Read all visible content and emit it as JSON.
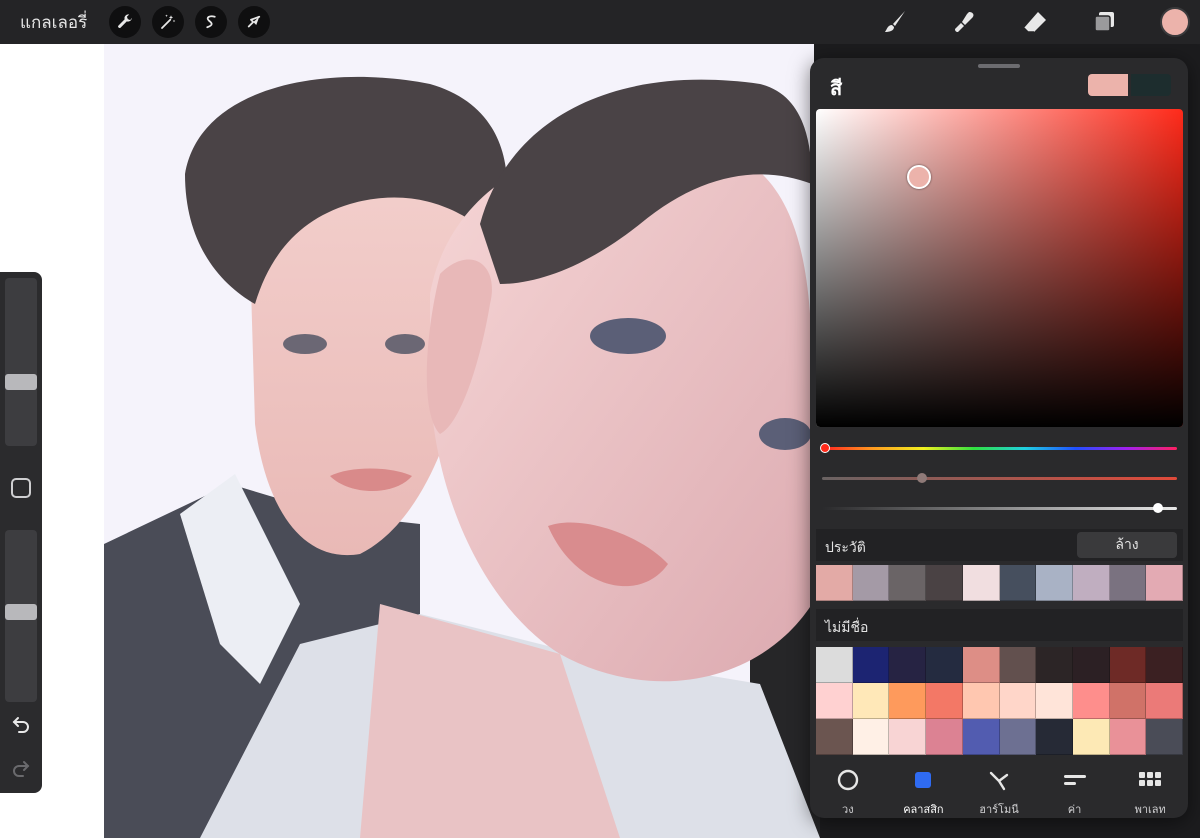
{
  "topbar": {
    "gallery_label": "แกลเลอรี่",
    "left_tools": [
      "wrench-icon",
      "magic-wand-icon",
      "selection-s-icon",
      "transform-arrow-icon"
    ],
    "right_tools": [
      "brush-icon",
      "smudge-icon",
      "eraser-icon",
      "layers-icon"
    ],
    "current_color": "#ecb3ab"
  },
  "panel": {
    "title": "สี",
    "primary_color": "#ecb3ab",
    "secondary_color": "#1d2d2e",
    "hue_color": "#ff2a1a",
    "history_label": "ประวัติ",
    "clear_label": "ล้าง",
    "history_colors": [
      "#e3aaa6",
      "#a49aa6",
      "#6a6466",
      "#4a4244",
      "#f1dee0",
      "#464f5e",
      "#a9b2c5",
      "#c0aec0",
      "#7a7280",
      "#e3aab3"
    ],
    "palette_label": "ไม่มีชื่อ",
    "palette_rows": [
      [
        "#dcdcdc",
        "#1c2472",
        "#262343",
        "#242b40",
        "#dd8e86",
        "#62504e",
        "#2c2526",
        "#2c2024",
        "#6e2a26",
        "#3b2022"
      ],
      [
        "#ffd1d1",
        "#ffe8b8",
        "#fe9a5c",
        "#f37866",
        "#ffc7b0",
        "#ffd6c9",
        "#ffe4d9",
        "#fe8e8c",
        "#d07268",
        "#eb7a78"
      ],
      [
        "#6b5550",
        "#fff0e6",
        "#f8d4d4",
        "#dc8293",
        "#525cb0",
        "#6d7092",
        "#262a36",
        "#fde9b5",
        "#e99198",
        "#4a4c57"
      ]
    ],
    "tabs": [
      {
        "label": "วง",
        "icon": "disc-icon",
        "active": false
      },
      {
        "label": "คลาสสิก",
        "icon": "classic-square-icon",
        "active": true
      },
      {
        "label": "ฮาร์โมนี",
        "icon": "harmony-icon",
        "active": false
      },
      {
        "label": "ค่า",
        "icon": "value-sliders-icon",
        "active": false
      },
      {
        "label": "พาเลท",
        "icon": "palette-grid-icon",
        "active": false
      }
    ],
    "accent_color": "#2f6bf2"
  }
}
